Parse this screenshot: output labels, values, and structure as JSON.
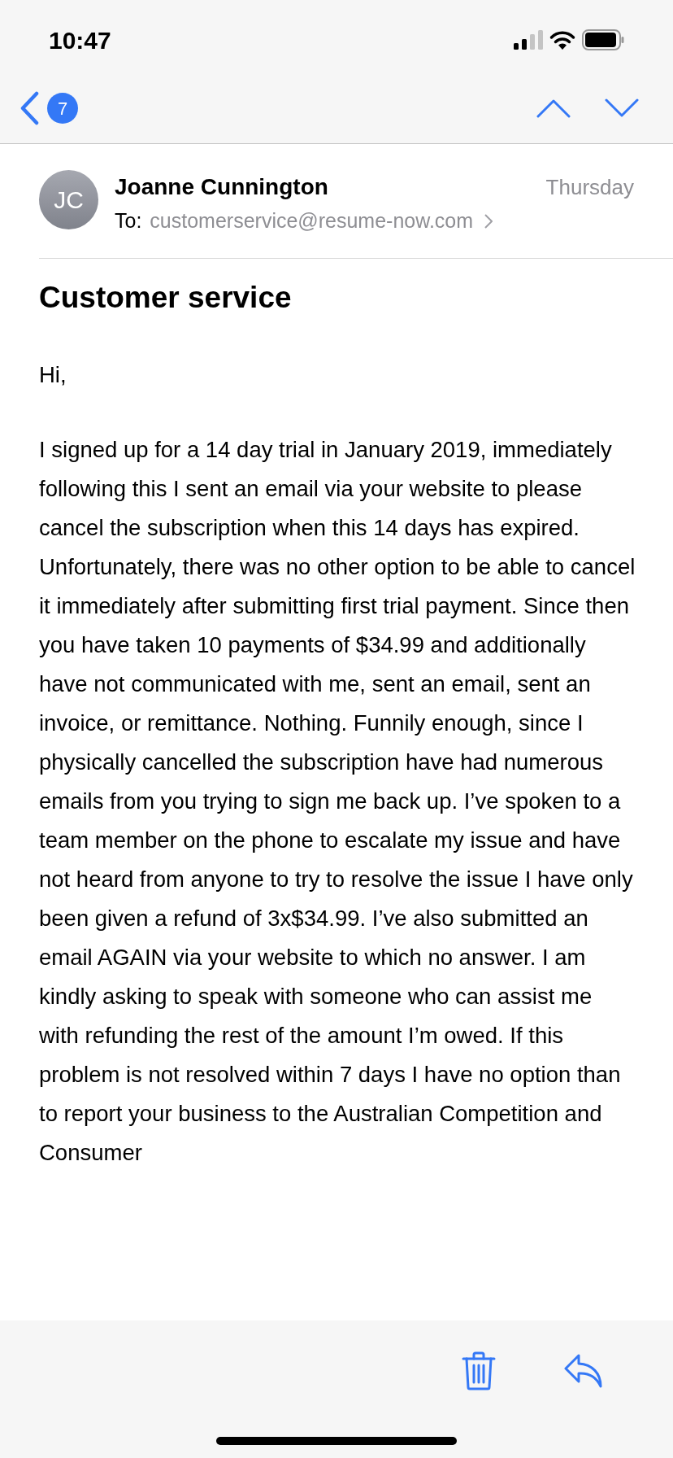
{
  "status_bar": {
    "time": "10:47"
  },
  "nav": {
    "unread_count": "7"
  },
  "message": {
    "sender": "Joanne Cunnington",
    "initials": "JC",
    "date": "Thursday",
    "to_label": "To:",
    "to": "customerservice@resume-now.com",
    "subject": "Customer service",
    "paragraphs": [
      "Hi,",
      "I signed up for a 14 day trial in January 2019, immediately following this I sent an email via your website to please cancel the subscription when this 14 days has expired. Unfortunately, there was no other option to be able to cancel it immediately after submitting first trial payment. Since then you have taken 10 payments of $34.99 and additionally have not communicated with me, sent an email, sent an invoice, or remittance. Nothing. Funnily enough, since I physically cancelled the subscription have had numerous emails from you trying to sign me back up. I’ve spoken to a team member on the phone to escalate my issue and have not heard from anyone to try to resolve the issue I have only been given a refund of 3x$34.99. I’ve also submitted an email AGAIN via your website to which no answer. I am kindly asking to speak with someone who can assist me with refunding the rest of the amount I’m owed. If this problem is not resolved within 7 days I have no option than to report your business to the Australian Competition and Consumer"
    ]
  }
}
